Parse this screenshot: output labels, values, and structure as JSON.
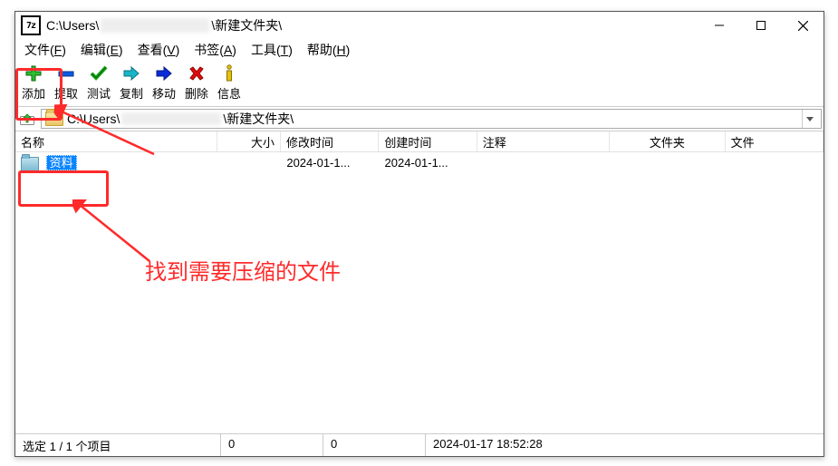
{
  "window": {
    "path_prefix": "C:\\Users\\",
    "path_suffix": "\\新建文件夹\\"
  },
  "menu": {
    "file": {
      "label_a": "文件(",
      "key": "F",
      "label_b": ")"
    },
    "edit": {
      "label_a": "编辑(",
      "key": "E",
      "label_b": ")"
    },
    "view": {
      "label_a": "查看(",
      "key": "V",
      "label_b": ")"
    },
    "book": {
      "label_a": "书签(",
      "key": "A",
      "label_b": ")"
    },
    "tools": {
      "label_a": "工具(",
      "key": "T",
      "label_b": ")"
    },
    "help": {
      "label_a": "帮助(",
      "key": "H",
      "label_b": ")"
    }
  },
  "toolbar": {
    "add": "添加",
    "extract": "提取",
    "test": "测试",
    "copy": "复制",
    "move": "移动",
    "delete": "删除",
    "info": "信息"
  },
  "address": {
    "prefix": "C:\\Users\\",
    "suffix": "\\新建文件夹\\"
  },
  "columns": {
    "name": "名称",
    "size": "大小",
    "mtime": "修改时间",
    "ctime": "创建时间",
    "comment": "注释",
    "folders": "文件夹",
    "files": "文件"
  },
  "rows": [
    {
      "name": "资料",
      "size": "",
      "mtime": "2024-01-1...",
      "ctime": "2024-01-1...",
      "comment": "",
      "folders": "",
      "files": ""
    }
  ],
  "status": {
    "sel": "选定 1 / 1 个项目",
    "size1": "0",
    "size2": "0",
    "date": "2024-01-17 18:52:28"
  },
  "annotation": {
    "label": "找到需要压缩的文件"
  },
  "app_icon_text": "7z"
}
